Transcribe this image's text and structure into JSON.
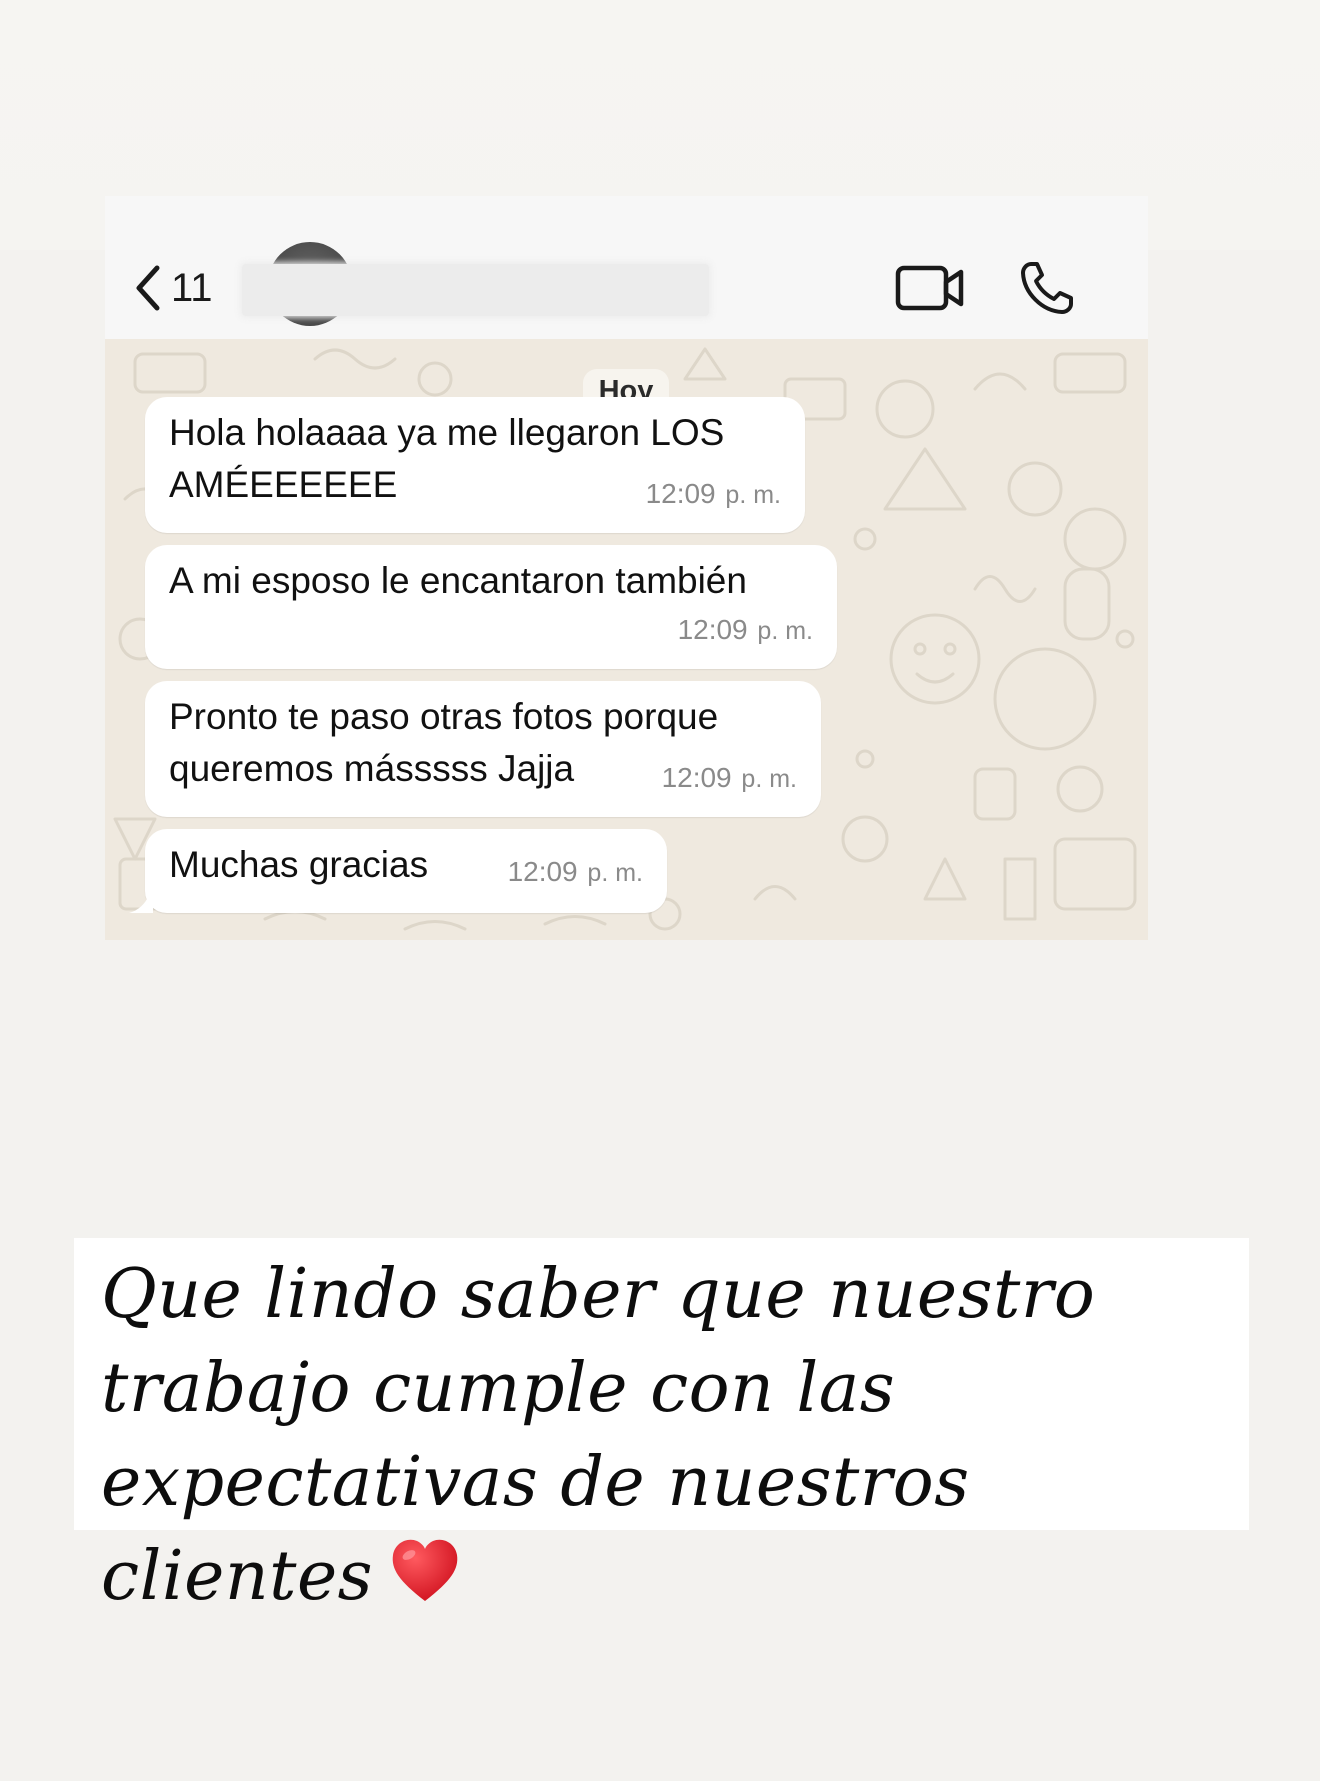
{
  "header": {
    "unread_count": "11",
    "icons": [
      "chevron-left-icon",
      "video-camera-icon",
      "phone-icon"
    ]
  },
  "chat": {
    "date_label": "Hoy",
    "messages": [
      {
        "text": "Hola holaaaa ya me llegaron LOS\nAMÉEEEEEE",
        "time": "12:09",
        "ampm": "p. m."
      },
      {
        "text": "A mi esposo le encantaron también",
        "time": "12:09",
        "ampm": "p. m."
      },
      {
        "text": "Pronto te paso otras fotos porque\nqueremos másssss Jajja",
        "time": "12:09",
        "ampm": "p. m."
      },
      {
        "text": "Muchas gracias",
        "time": "12:09",
        "ampm": "p. m."
      }
    ]
  },
  "caption": {
    "text": "Que lindo saber que nuestro trabajo cumple con las expectativas de nuestros clientes",
    "icon": "heart-icon"
  },
  "colors": {
    "background": "#f3f2ef",
    "chat_wallpaper": "#efe9df",
    "bubble": "#ffffff",
    "timestamp": "#8a8a8a",
    "heart": "#e01e2b"
  }
}
